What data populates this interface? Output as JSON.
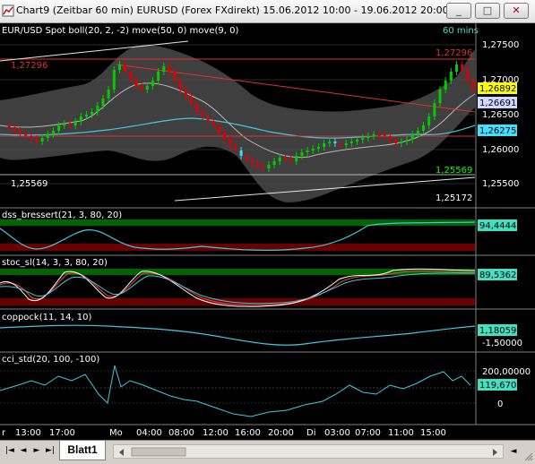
{
  "window": {
    "title": "Chart9 (Zeitbar 60 min)  EURUSD (Forex FXdirekt) 15.06.2012 10:00 - 19.06.2012 20:00",
    "minimize_label": "_",
    "maximize_label": "□",
    "close_label": "✕"
  },
  "main_panel": {
    "header_left": "EUR/USD Spot boll(20, 2, -2) move(50, 0) move(9, 0)",
    "header_right": "60 mins",
    "price_axis": [
      "1,27500",
      "1,27000",
      "1,26500",
      "1,26000",
      "1,25500"
    ],
    "current_price_tags": [
      "1,26892",
      "1,26691",
      "1,26275"
    ],
    "level_labels": {
      "high_left": "1,27296",
      "high_right": "1,27296",
      "low_left": "1,25569",
      "low_right": "1,25569",
      "bottom_right": "1,25172"
    }
  },
  "indicators": [
    {
      "name": "dss_bressert(21, 3, 80, 20)",
      "value_tag": "94,44442"
    },
    {
      "name": "stoc_sl(14, 3, 3, 80, 20)",
      "value_tag": "89,53627"
    },
    {
      "name": "coppock(11, 14, 10)",
      "value_tag": "1,18059",
      "axis": [
        "-1,50000"
      ]
    },
    {
      "name": "cci_std(20, 100, -100)",
      "value_tag": "119,67037",
      "axis": [
        "200,00000",
        "0"
      ]
    }
  ],
  "time_axis": [
    "r",
    "13:00",
    "17:00",
    "Mo",
    "04:00",
    "08:00",
    "12:00",
    "16:00",
    "20:00",
    "Di",
    "03:00",
    "07:00",
    "11:00",
    "15:00"
  ],
  "sheet_tab": "Blatt1",
  "colors": {
    "background": "#000000",
    "bull_candle": "#00cc00",
    "bear_candle": "#dd0000",
    "neutral_candle": "#40d8ff",
    "bollinger_fill": "#4a4a4a",
    "ma50": "#40c8e0",
    "ma9": "#b0b0b0",
    "level_line": "#e03030",
    "overbought_zone": "#006400",
    "oversold_zone": "#6a0000"
  }
}
